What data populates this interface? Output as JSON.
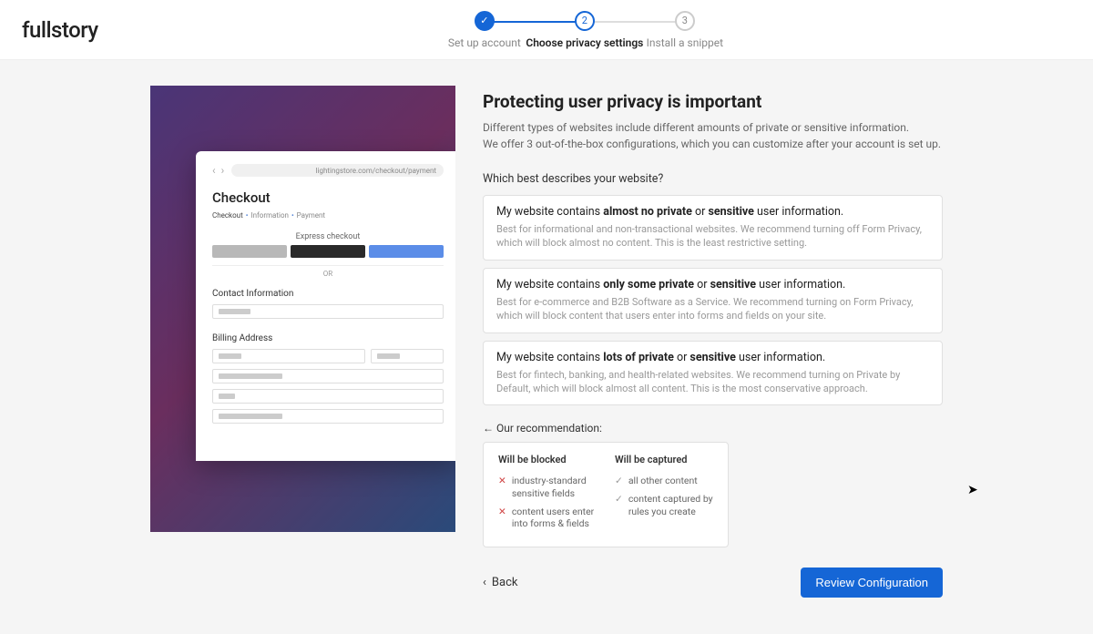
{
  "logo": "fullstory",
  "stepper": {
    "steps": [
      {
        "num": "✓",
        "label": "Set up account",
        "state": "done"
      },
      {
        "num": "2",
        "label": "Choose privacy settings",
        "state": "active"
      },
      {
        "num": "3",
        "label": "Install a snippet",
        "state": "pending"
      }
    ]
  },
  "preview": {
    "url": "lightingstore.com/checkout/payment",
    "title": "Checkout",
    "breadcrumb": {
      "a": "Checkout",
      "b": "Information",
      "c": "Payment"
    },
    "express_label": "Express checkout",
    "or_label": "OR",
    "contact_label": "Contact Information",
    "billing_label": "Billing Address"
  },
  "content": {
    "heading": "Protecting user privacy is important",
    "sub1": "Different types of websites include different amounts of private or sensitive information.",
    "sub2": "We offer 3 out-of-the-box configurations, which you can customize after your account is set up.",
    "question": "Which best describes your website?",
    "options": [
      {
        "title_pre": "My website contains ",
        "title_bold": "almost no private",
        "title_mid": " or ",
        "title_bold2": "sensitive",
        "title_post": " user information.",
        "desc": "Best for informational and non-transactional websites. We recommend turning off Form Privacy, which will block almost no content. This is the least restrictive setting."
      },
      {
        "title_pre": "My website contains ",
        "title_bold": "only some private",
        "title_mid": " or ",
        "title_bold2": "sensitive",
        "title_post": " user information.",
        "desc": "Best for e-commerce and B2B Software as a Service. We recommend turning on Form Privacy, which will block content that users enter into forms and fields on your site."
      },
      {
        "title_pre": "My website contains ",
        "title_bold": "lots of private",
        "title_mid": " or ",
        "title_bold2": "sensitive",
        "title_post": " user information.",
        "desc": "Best for fintech, banking, and health-related websites. We recommend turning on Private by Default, which will block almost all content. This is the most conservative approach."
      }
    ],
    "reco_label": "Our recommendation:",
    "reco": {
      "blocked_h": "Will be blocked",
      "captured_h": "Will be captured",
      "blocked": [
        "industry-standard sensitive fields",
        "content users enter into forms & fields"
      ],
      "captured": [
        "all other content",
        "content captured by rules you create"
      ]
    },
    "back_label": "Back",
    "cta_label": "Review Configuration"
  }
}
